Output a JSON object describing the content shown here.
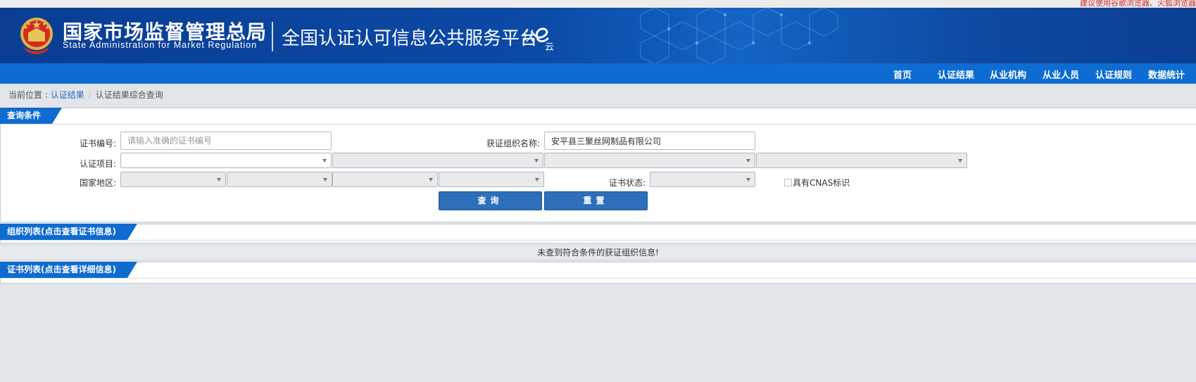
{
  "top_notice": "建议使用谷歌浏览器、火狐浏览器",
  "header": {
    "org_name_cn": "国家市场监督管理总局",
    "org_name_en": "State Administration  for  Market Regulation",
    "platform_name": "全国认证认可信息公共服务平台",
    "logo_text": "认e云"
  },
  "nav": {
    "items": [
      {
        "label": "首页"
      },
      {
        "label": "认证结果"
      },
      {
        "label": "从业机构"
      },
      {
        "label": "从业人员"
      },
      {
        "label": "认证规则"
      },
      {
        "label": "数据统计"
      }
    ]
  },
  "breadcrumb": {
    "prefix": "当前位置 : ",
    "link": "认证结果",
    "separator": "/",
    "current": "认证结果综合查询"
  },
  "query_panel": {
    "title": "查询条件",
    "cert_no_label": "证书编号:",
    "cert_no_placeholder": "请输入准确的证书编号",
    "org_name_label": "获证组织名称:",
    "org_name_value": "安平县三聚丝网制品有限公司",
    "project_label": "认证项目:",
    "region_label": "国家地区:",
    "status_label": "证书状态:",
    "cnas_label": "具有CNAS标识",
    "query_button": "查询",
    "reset_button": "重置"
  },
  "org_list": {
    "title": "组织列表(点击查看证书信息)",
    "empty_message": "未查到符合条件的获证组织信息!"
  },
  "cert_list": {
    "title": "证书列表(点击查看详细信息)"
  },
  "colors": {
    "nav_blue": "#0d6cd1",
    "banner_blue": "#0b4aa6",
    "button_blue": "#2d6fb9",
    "notice_red": "#d4282a"
  }
}
